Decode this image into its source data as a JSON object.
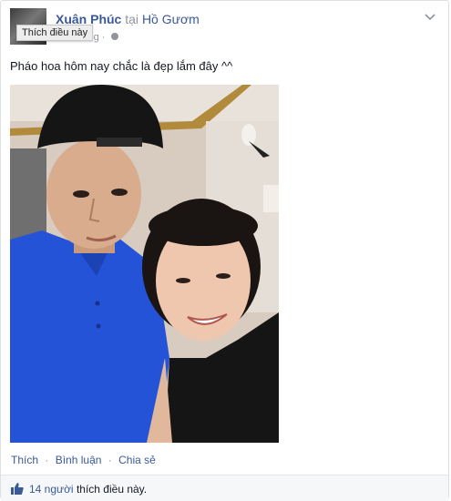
{
  "post": {
    "author": "Xuân Phúc",
    "at_word": "tại",
    "place": "Hồ Gươm",
    "time": "Vừa xong",
    "tooltip": "Thích điều này",
    "status_text": "Pháo hoa hôm nay chắc là đẹp lắm đây ^^"
  },
  "actions": {
    "like": "Thích",
    "comment": "Bình luận",
    "share": "Chia sẻ",
    "separator": "·"
  },
  "likes": {
    "count_label": "14 người",
    "suffix": "thích điều này."
  },
  "colors": {
    "link": "#3b5998",
    "muted": "#90949c",
    "likes_bar_bg": "#f6f7f9"
  },
  "icons": [
    "globe-icon",
    "chevron-down-icon",
    "thumbs-up-icon"
  ]
}
